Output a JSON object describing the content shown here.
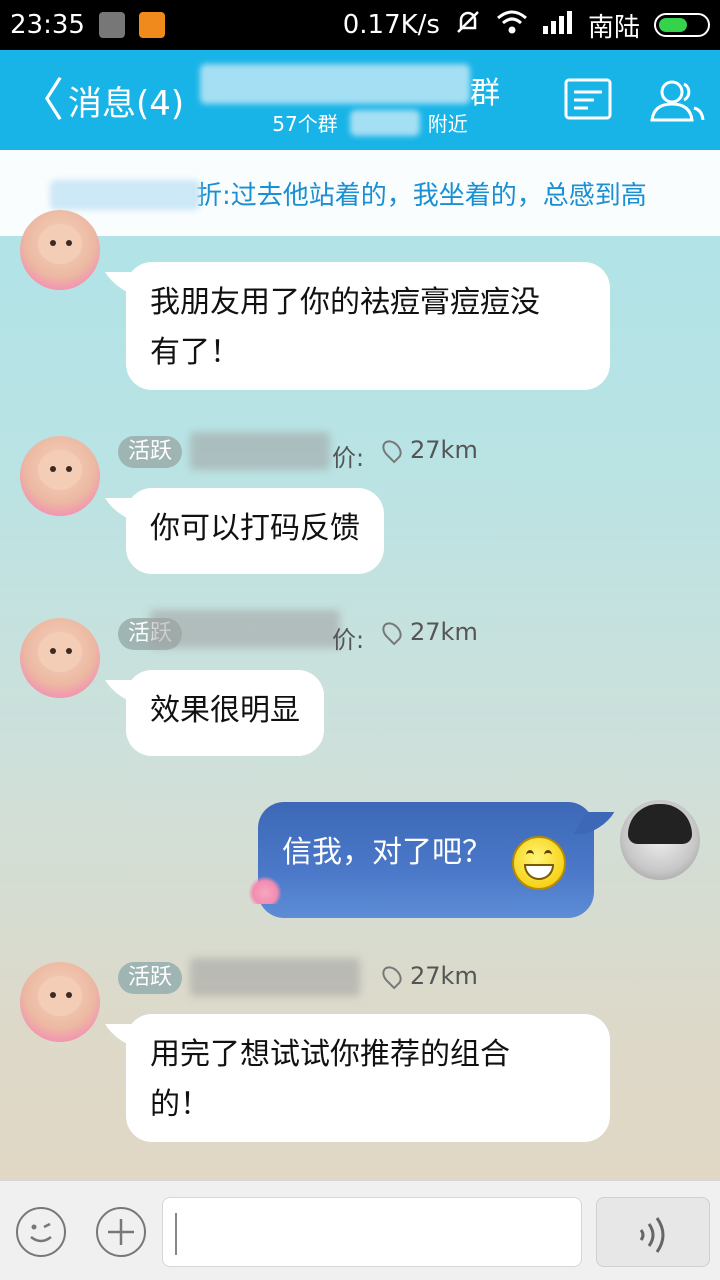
{
  "status_bar": {
    "time": "23:35",
    "speed": "0.17K/s",
    "carrier": "南陆"
  },
  "header": {
    "back_label": "消息(4)",
    "title_suffix": "群",
    "subtitle_prefix": "57个群",
    "subtitle_suffix": "附近"
  },
  "banner": {
    "text": "折:过去他站着的，我坐着的，总感到高"
  },
  "messages": [
    {
      "badge": "",
      "name_tail": "代理价:",
      "distance": "27km",
      "text_line1": "我朋友用了你的祛痘膏痘痘没",
      "text_line2": "有了！"
    },
    {
      "badge": "活跃",
      "name_tail": "价:",
      "distance": "27km",
      "text": "你可以打码反馈"
    },
    {
      "badge": "活跃",
      "name_tail": "价:",
      "distance": "27km",
      "text": "效果很明显"
    },
    {
      "badge": "",
      "name_tail": "",
      "distance": "",
      "text": "信我，对了吧？"
    },
    {
      "badge": "活跃",
      "name_tail": "",
      "distance": "27km",
      "text_line1": "用完了想试试你推荐的组合",
      "text_line2": "的！"
    }
  ],
  "input": {
    "placeholder": ""
  }
}
